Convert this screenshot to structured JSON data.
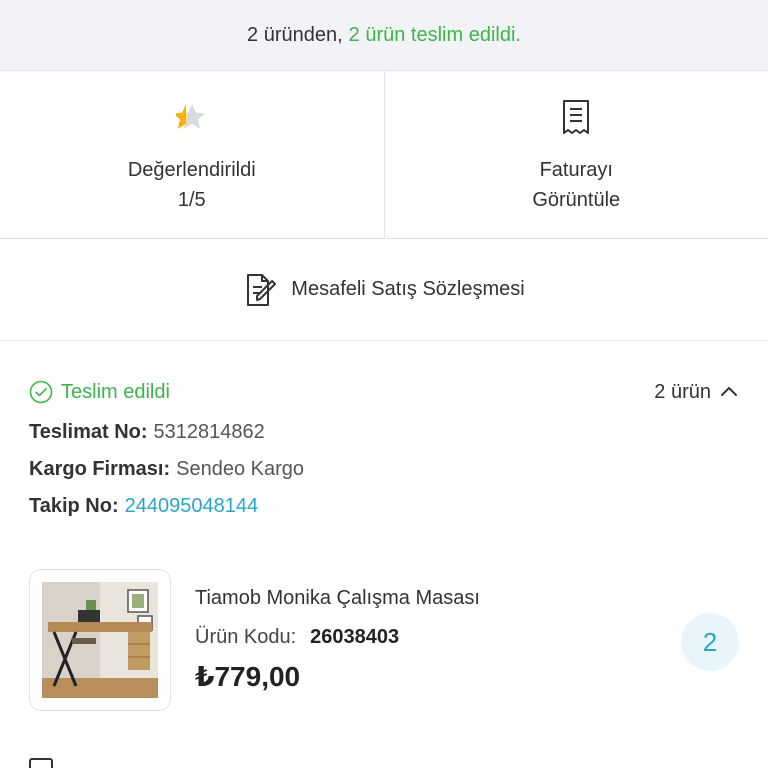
{
  "banner": {
    "count_text": "2 üründen,",
    "delivered_text": "2 ürün teslim edildi.",
    "accent_color": "#3fb44a"
  },
  "actions": [
    {
      "icon": "star-icon",
      "label_line1": "Değerlendirildi",
      "label_line2": "1/5"
    },
    {
      "icon": "receipt-icon",
      "label_line1": "Faturayı",
      "label_line2": "Görüntüle"
    }
  ],
  "contract": {
    "icon": "document-edit-icon",
    "label": "Mesafeli Satış Sözleşmesi"
  },
  "shipment": {
    "status": "Teslim edildi",
    "status_icon": "check-circle-icon",
    "item_count": "2 ürün",
    "toggle_icon": "chevron-up-icon",
    "delivery_no_label": "Teslimat No:",
    "delivery_no": "5312814862",
    "carrier_label": "Kargo Firması:",
    "carrier": "Sendeo Kargo",
    "tracking_label": "Takip No:",
    "tracking_no": "244095048144",
    "link_color": "#2aa5c8"
  },
  "product": {
    "name": "Tiamob Monika Çalışma Masası",
    "code_label": "Ürün Kodu:",
    "code": "26038403",
    "price": "₺779,00",
    "quantity": "2"
  }
}
